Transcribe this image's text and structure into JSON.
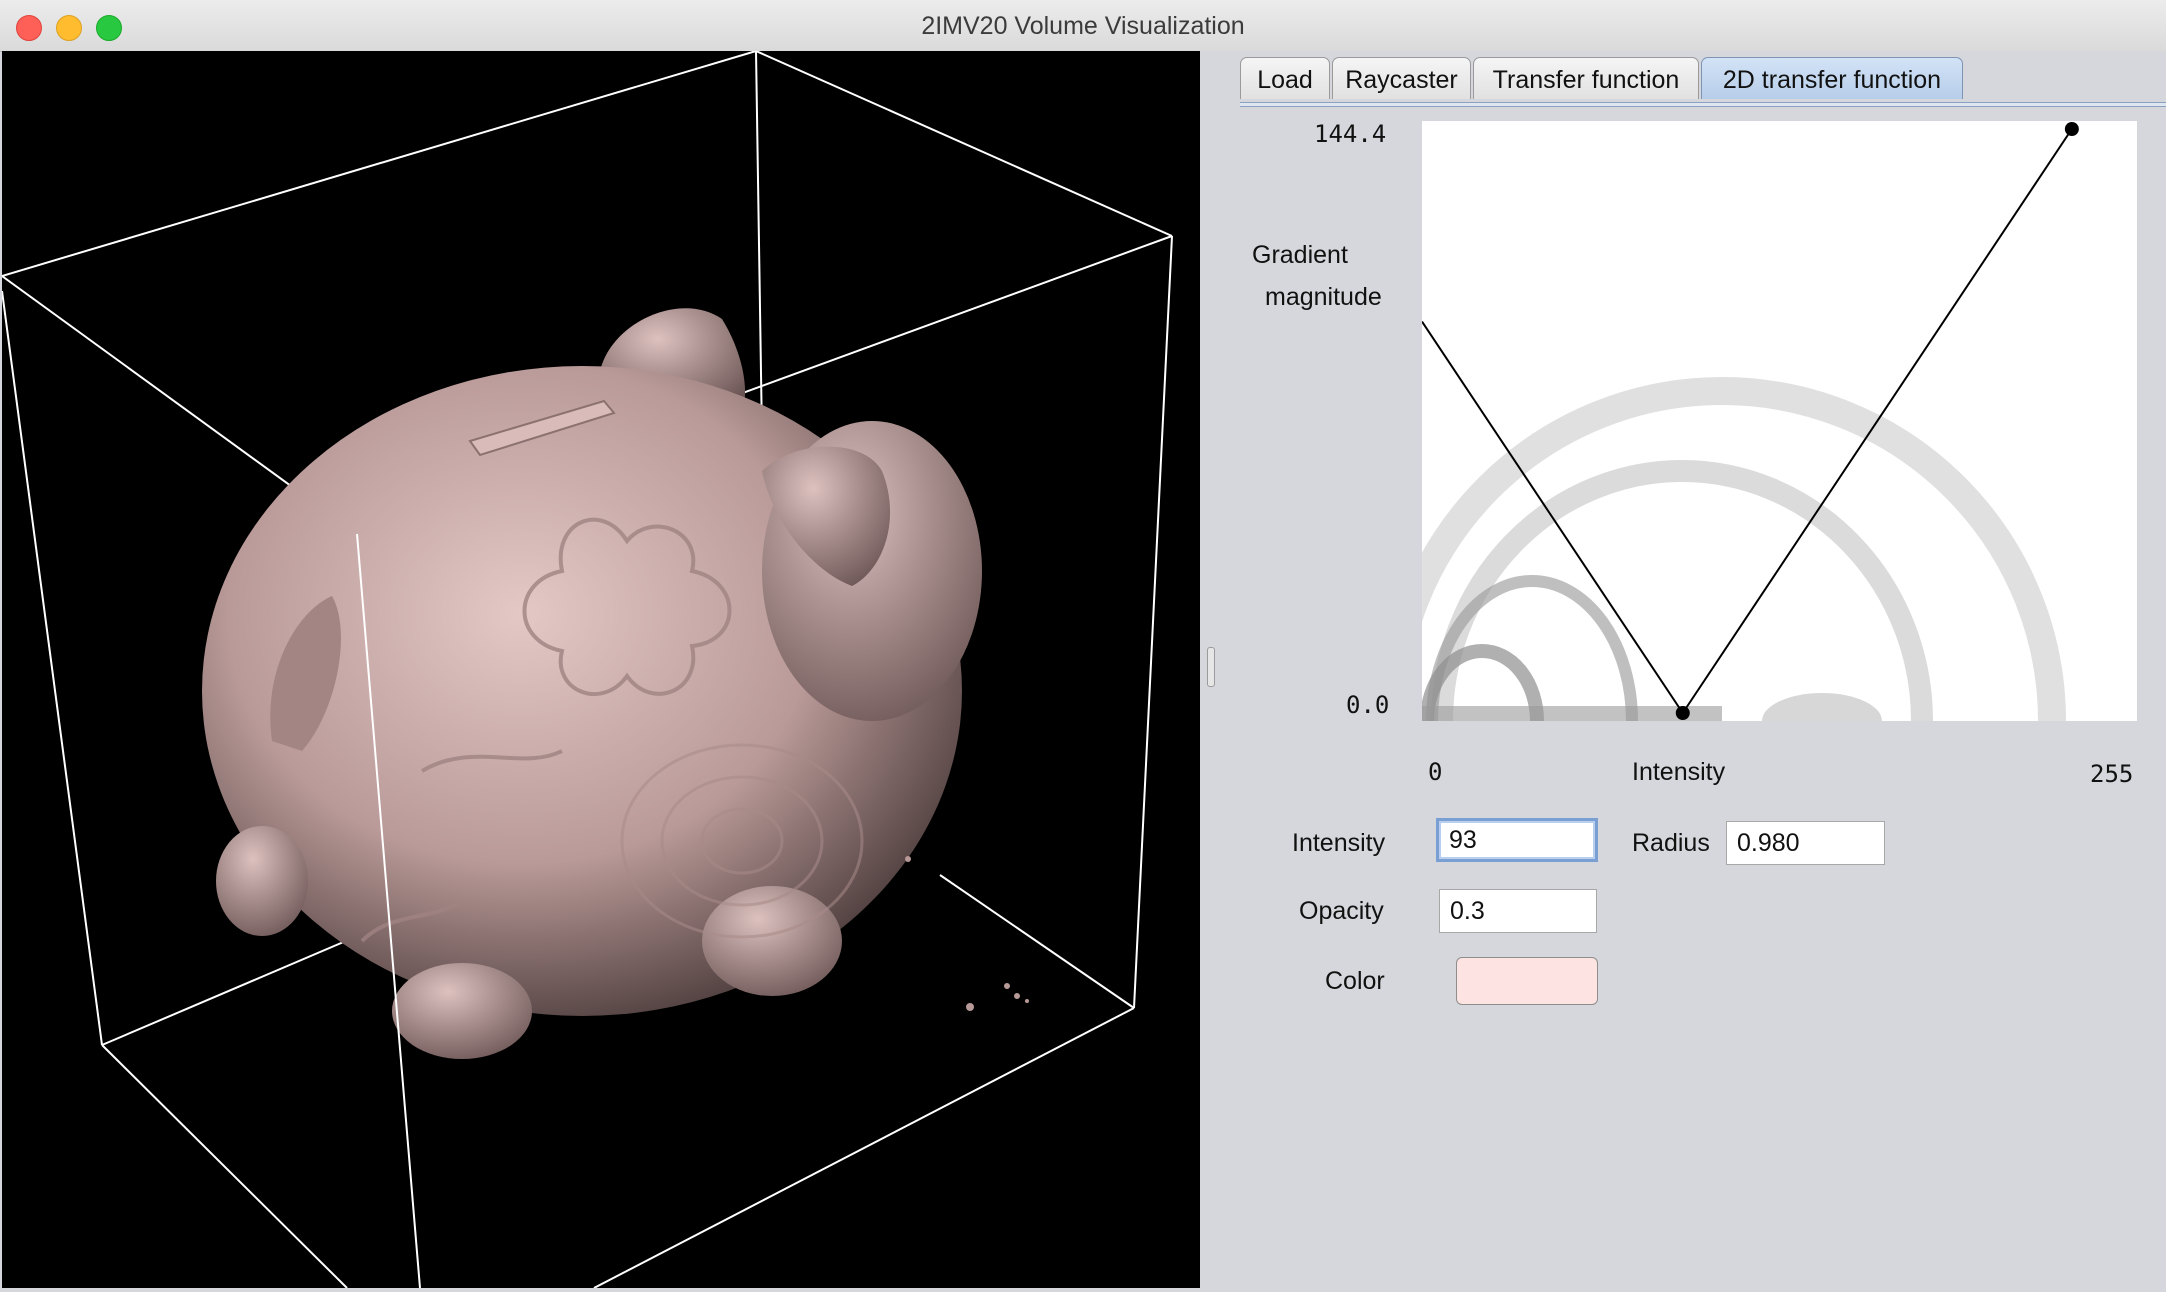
{
  "window": {
    "title": "2IMV20 Volume Visualization"
  },
  "colors": {
    "volume": "#c9aba9",
    "bbox_lines": "#ffffff",
    "tf_color": "#fde3e1",
    "active_tab": "#b6cde9"
  },
  "tabs": [
    {
      "label": "Load",
      "active": false
    },
    {
      "label": "Raycaster",
      "active": false
    },
    {
      "label": "Transfer function",
      "active": false
    },
    {
      "label": "2D transfer function",
      "active": true
    }
  ],
  "tf2d": {
    "y_label_line1": "Gradient",
    "y_label_line2": "magnitude",
    "y_max": "144.4",
    "y_min": "0.0",
    "x_min": "0",
    "x_max": "255",
    "x_label": "Intensity",
    "triangle": {
      "intensity": 93,
      "radius": 0.98,
      "gradient_max": 144.4
    }
  },
  "controls": {
    "intensity_label": "Intensity",
    "intensity_value": "93",
    "radius_label": "Radius",
    "radius_value": "0.980",
    "opacity_label": "Opacity",
    "opacity_value": "0.3",
    "color_label": "Color"
  }
}
